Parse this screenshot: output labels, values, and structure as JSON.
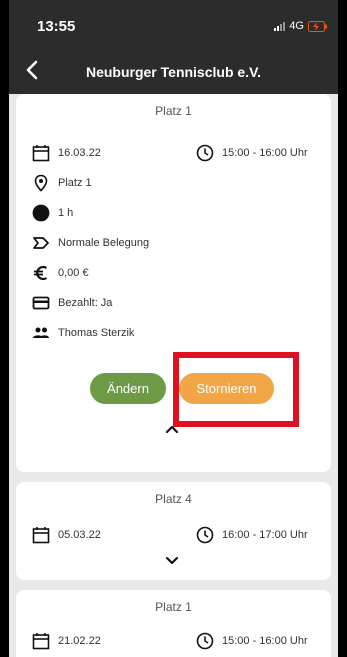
{
  "status_bar": {
    "time": "13:55",
    "network": "4G"
  },
  "header": {
    "title": "Neuburger Tennisclub e.V."
  },
  "bookings": [
    {
      "court": "Platz 1",
      "date": "16.03.22",
      "time_range": "15:00 - 16:00 Uhr",
      "location": "Platz 1",
      "duration": "1 h",
      "booking_type": "Normale Belegung",
      "price": "0,00 €",
      "paid": "Bezahlt: Ja",
      "players": "Thomas Sterzik",
      "buttons": {
        "edit": "Ändern",
        "cancel": "Stornieren"
      },
      "expanded": true
    },
    {
      "court": "Platz 4",
      "date": "05.03.22",
      "time_range": "16:00 - 17:00 Uhr",
      "expanded": false
    },
    {
      "court": "Platz 1",
      "date": "21.02.22",
      "time_range": "15:00 - 16:00 Uhr",
      "expanded": false
    }
  ],
  "colors": {
    "header_bg": "#2c2c2c",
    "edit_button": "#6e9a45",
    "cancel_button": "#f2a545",
    "highlight_box": "#e01020",
    "page_bg": "#e9e9e9"
  },
  "icons": [
    "back-icon",
    "calendar-icon",
    "clock-icon",
    "location-pin-icon",
    "duration-icon",
    "booking-type-icon",
    "euro-icon",
    "card-icon",
    "people-icon",
    "chevron-up-icon",
    "chevron-down-icon"
  ]
}
